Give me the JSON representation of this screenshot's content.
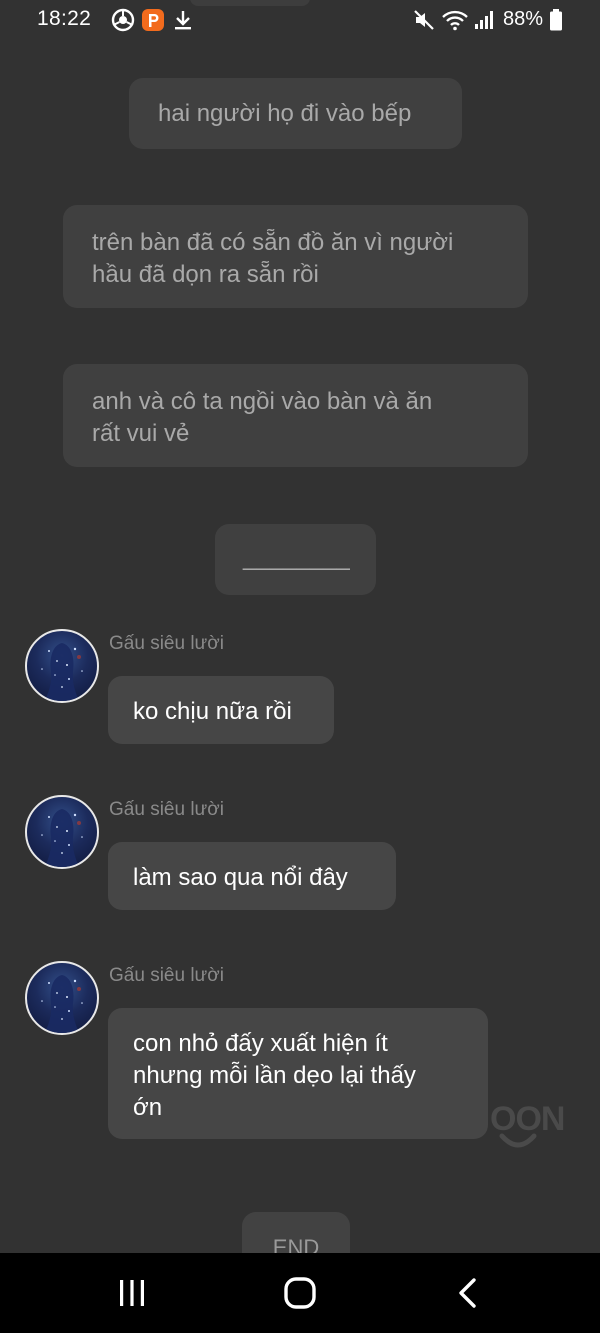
{
  "status_bar": {
    "time": "18:22",
    "battery_percent": "88%",
    "icons": [
      "chrome-circle-icon",
      "p-app-icon",
      "download-icon",
      "mute-icon",
      "wifi-icon",
      "signal-icon",
      "battery-icon"
    ]
  },
  "narration": [
    {
      "lines": [
        "hai người họ đi vào bếp"
      ]
    },
    {
      "lines": [
        "trên bàn đã có sẵn đồ ăn vì người",
        "hầu đã dọn ra sẵn rồi"
      ]
    },
    {
      "lines": [
        "anh và cô ta ngồi vào bàn và ăn",
        "rất vui vẻ"
      ]
    },
    {
      "lines": [
        "________"
      ]
    }
  ],
  "messages": [
    {
      "sender": "Gấu siêu lười",
      "lines": [
        "ko chịu nữa rồi"
      ]
    },
    {
      "sender": "Gấu siêu lười",
      "lines": [
        "làm sao qua nổi đây"
      ]
    },
    {
      "sender": "Gấu siêu lười",
      "lines": [
        "con nhỏ đấy xuất hiện ít",
        "nhưng mỗi lần dẹo lại thấy",
        "ớn"
      ]
    }
  ],
  "watermark": "OON",
  "end_label": "END",
  "colors": {
    "background": "#323232",
    "narration_bubble": "#404040",
    "message_bubble": "#464646",
    "narration_text": "#a9a9a9",
    "sender_text": "#8a8a8a",
    "nav_bar": "#000000"
  }
}
